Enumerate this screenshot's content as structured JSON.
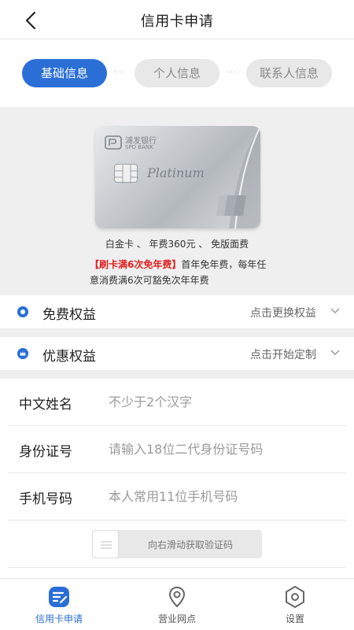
{
  "header": {
    "title": "信用卡申请",
    "back_icon": "back-arrow-icon"
  },
  "steps": [
    {
      "label": "基础信息",
      "active": true
    },
    {
      "label": "个人信息",
      "active": false
    },
    {
      "label": "联系人信息",
      "active": false
    }
  ],
  "step_separator": "···",
  "card": {
    "bank_name_cn": "浦发银行",
    "bank_name_en": "SPD BANK",
    "tier_text": "Platinum",
    "network": "UnionPay 银联",
    "description": "白金卡 、 年费360元 、 免版面费",
    "promo_highlight": "【刷卡满6次免年费】",
    "promo_text": "首年免年费，每年任意消费满6次可豁免次年年费"
  },
  "benefits": [
    {
      "label": "免费权益",
      "action": "点击更换权益",
      "icon": "benefit-icon"
    },
    {
      "label": "优惠权益",
      "action": "点击开始定制",
      "icon": "crown-icon"
    }
  ],
  "form": {
    "name": {
      "label": "中文姓名",
      "placeholder": "不少于2个汉字"
    },
    "id_number": {
      "label": "身份证号",
      "placeholder": "请输入18位二代身份证号码"
    },
    "phone": {
      "label": "手机号码",
      "placeholder": "本人常用11位手机号码"
    }
  },
  "slider": {
    "text": "向右滑动获取验证码"
  },
  "nav": [
    {
      "label": "信用卡申请",
      "icon": "card-apply-icon",
      "active": true
    },
    {
      "label": "营业网点",
      "icon": "location-pin-icon",
      "active": false
    },
    {
      "label": "设置",
      "icon": "settings-hex-icon",
      "active": false
    }
  ],
  "colors": {
    "accent": "#2b6fd6",
    "promo_red": "#e02020",
    "background_gray": "#efefef"
  }
}
